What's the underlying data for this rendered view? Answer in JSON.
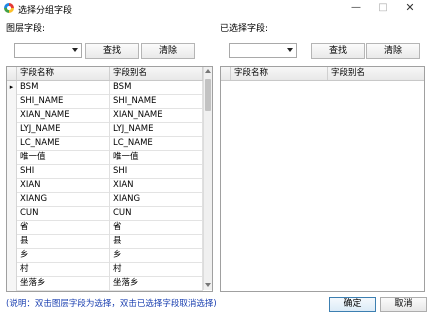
{
  "window": {
    "title": "选择分组字段",
    "minimize": "—",
    "maximize": "□",
    "close": "✕"
  },
  "left": {
    "label": "图层字段:",
    "combo_value": "",
    "search_btn": "查找",
    "clear_btn": "清除",
    "columns": [
      "字段名称",
      "字段别名"
    ],
    "current_row_marker": "▸",
    "rows": [
      [
        "BSM",
        "BSM"
      ],
      [
        "SHI_NAME",
        "SHI_NAME"
      ],
      [
        "XIAN_NAME",
        "XIAN_NAME"
      ],
      [
        "LYJ_NAME",
        "LYJ_NAME"
      ],
      [
        "LC_NAME",
        "LC_NAME"
      ],
      [
        "唯一值",
        "唯一值"
      ],
      [
        "SHI",
        "SHI"
      ],
      [
        "XIAN",
        "XIAN"
      ],
      [
        "XIANG",
        "XIANG"
      ],
      [
        "CUN",
        "CUN"
      ],
      [
        "省",
        "省"
      ],
      [
        "县",
        "县"
      ],
      [
        "乡",
        "乡"
      ],
      [
        "村",
        "村"
      ],
      [
        "坐落乡",
        "坐落乡"
      ],
      [
        "坐落村",
        "坐落村"
      ]
    ]
  },
  "right": {
    "label": "已选择字段:",
    "combo_value": "",
    "search_btn": "查找",
    "clear_btn": "清除",
    "columns": [
      "字段名称",
      "字段别名"
    ]
  },
  "footer": {
    "note": "(说明：双击图层字段为选择，双击已选择字段取消选择)",
    "ok": "确定",
    "cancel": "取消"
  }
}
